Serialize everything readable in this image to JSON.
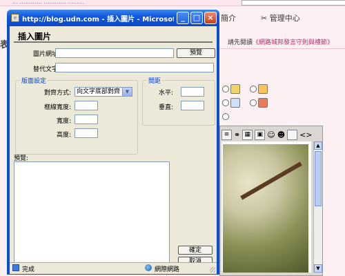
{
  "background_page": {
    "top_strip": "… …………  …………  ………",
    "left_fragment": "表",
    "nav": [
      "簡介",
      "管理中心"
    ],
    "notice": {
      "prefix": "請先閱讀",
      "link": "《網路城邦發言守則與禮節》"
    }
  },
  "window": {
    "title": "http://blog.udn.com - 插入圖片 - Microsoft Internet ...",
    "buttons": {
      "minimize": "_",
      "maximize": "□",
      "close": "×"
    }
  },
  "dialog": {
    "heading": "插入圖片",
    "image_url_label": "圖片網址:",
    "image_url_value": "",
    "browse_button": "預覽",
    "alt_text_label": "替代文字:",
    "alt_text_value": "",
    "layout_group": {
      "title": "版面設定",
      "align_label": "對齊方式:",
      "align_value": "向文字底部對齊",
      "border_label": "框線寬度:",
      "border_value": "",
      "width_label": "寬度:",
      "width_value": "",
      "height_label": "高度:",
      "height_value": ""
    },
    "spacing_group": {
      "title": "間距",
      "horizontal_label": "水平:",
      "horizontal_value": "",
      "vertical_label": "垂直:",
      "vertical_value": ""
    },
    "preview_label": "預覽:",
    "ok_button": "確定",
    "cancel_button": "取消"
  },
  "statusbar": {
    "status": "完成",
    "zone": "網際網路"
  }
}
